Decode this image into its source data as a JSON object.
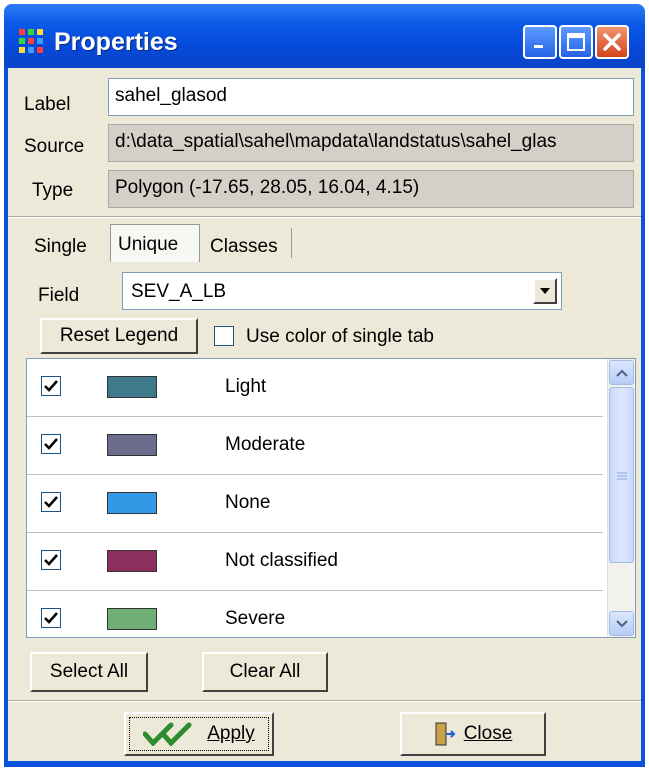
{
  "window": {
    "title": "Properties",
    "controls": {
      "minimize_icon": "minimize-icon",
      "maximize_icon": "maximize-icon",
      "close_icon": "close-icon"
    }
  },
  "layer": {
    "label_caption": "Label",
    "label_value": "sahel_glasod",
    "source_caption": "Source",
    "source_value": "d:\\data_spatial\\sahel\\mapdata\\landstatus\\sahel_glas",
    "type_caption": "Type",
    "type_value": "Polygon  (-17.65, 28.05, 16.04, 4.15)"
  },
  "tabs": [
    {
      "label": "Single",
      "active": false
    },
    {
      "label": "Unique",
      "active": true
    },
    {
      "label": "Classes",
      "active": false
    }
  ],
  "unique": {
    "field_caption": "Field",
    "field_value": "SEV_A_LB",
    "reset_legend_label": "Reset Legend",
    "use_color_label": "Use color of single tab",
    "use_color_checked": false
  },
  "legend_items": [
    {
      "label": "Light",
      "checked": true,
      "color": "#3f7a8c"
    },
    {
      "label": "Moderate",
      "checked": true,
      "color": "#6c6c8c"
    },
    {
      "label": "None",
      "checked": true,
      "color": "#3399e6"
    },
    {
      "label": "Not classified",
      "checked": true,
      "color": "#8c2f5e"
    },
    {
      "label": "Severe",
      "checked": true,
      "color": "#6fae74"
    }
  ],
  "list_buttons": {
    "select_all_label": "Select All",
    "clear_all_label": "Clear All"
  },
  "footer": {
    "apply_label": "Apply",
    "close_label": "Close"
  }
}
